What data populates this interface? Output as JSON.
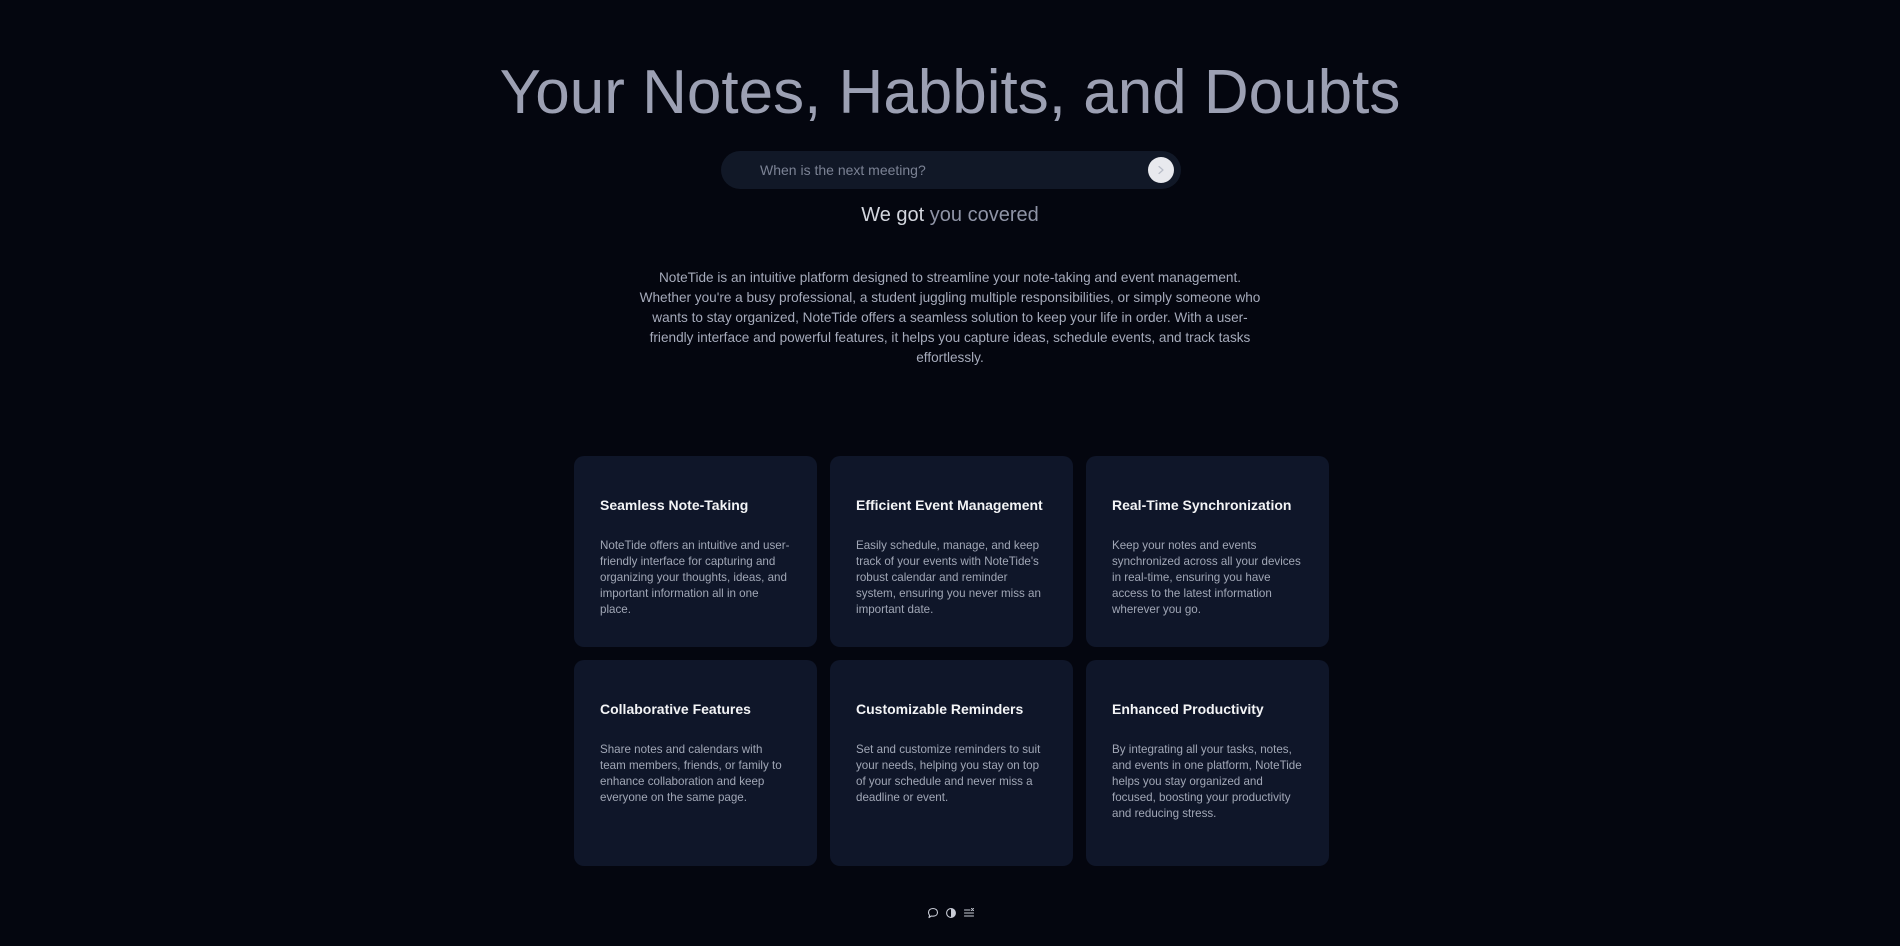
{
  "hero": {
    "title": "Your Notes, Habbits, and Doubts"
  },
  "search": {
    "placeholder": "When is the next meeting?",
    "value": ""
  },
  "subtitle": {
    "part1": "We got",
    "part2": " you covered"
  },
  "intro": {
    "text": "NoteTide is an intuitive platform designed to streamline your note-taking and event management. Whether you're a busy professional, a student juggling multiple responsibilities, or simply someone who wants to stay organized, NoteTide offers a seamless solution to keep your life in order. With a user-friendly interface and powerful features, it helps you capture ideas, schedule events, and track tasks effortlessly."
  },
  "features": [
    {
      "title": "Seamless Note-Taking",
      "text": "NoteTide offers an intuitive and user-friendly interface for capturing and organizing your thoughts, ideas, and important information all in one place."
    },
    {
      "title": "Efficient Event Management",
      "text": "Easily schedule, manage, and keep track of your events with NoteTide's robust calendar and reminder system, ensuring you never miss an important date."
    },
    {
      "title": "Real-Time Synchronization",
      "text": "Keep your notes and events synchronized across all your devices in real-time, ensuring you have access to the latest information wherever you go."
    },
    {
      "title": "Collaborative Features",
      "text": "Share notes and calendars with team members, friends, or family to enhance collaboration and keep everyone on the same page."
    },
    {
      "title": "Customizable Reminders",
      "text": "Set and customize reminders to suit your needs, helping you stay on top of your schedule and never miss a deadline or event."
    },
    {
      "title": "Enhanced Productivity",
      "text": "By integrating all your tasks, notes, and events in one platform, NoteTide helps you stay organized and focused, boosting your productivity and reducing stress."
    }
  ],
  "dock": {
    "icons": [
      "chat-icon",
      "theme-toggle-icon",
      "notes-list-icon"
    ]
  },
  "colors": {
    "background": "#04060f",
    "card": "#0f1629",
    "title": "#9ca0b3",
    "send_button": "#e8e9ee"
  }
}
